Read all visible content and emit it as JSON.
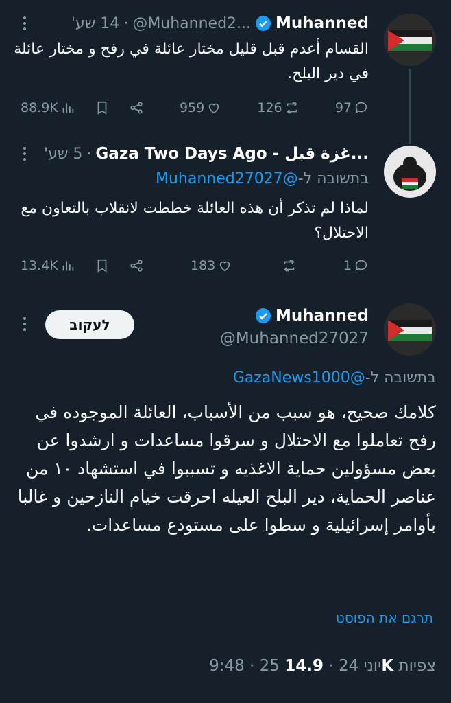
{
  "tweet1": {
    "name": "Muhanned",
    "handle": "@Muhanned2...",
    "time": "14 שע'",
    "text": "القسام أعدم قبل قليل مختار عائلة في رفح و مختار عائلة في دير البلح.",
    "stats": {
      "replies": "97",
      "reposts": "126",
      "likes": "959",
      "views": "88.9K"
    }
  },
  "tweet2": {
    "name": "Gaza Two Days Ago - غزة قبل...",
    "time": "5 שע'",
    "replying_prefix": "בתשובה ל-",
    "replying_to": "@Muhanned27027",
    "text": "لماذا لم تذكر أن هذه العائلة خططت لانقلاب بالتعاون مع الاحتلال؟",
    "stats": {
      "replies": "1",
      "reposts": "",
      "likes": "183",
      "views": "13.4K"
    }
  },
  "tweet3": {
    "name": "Muhanned",
    "handle": "@Muhanned27027",
    "follow_label": "לעקוב",
    "replying_prefix": "בתשובה ל-",
    "replying_to": "@GazaNews1000",
    "text": "كلامك صحيح، هو سبب من الأسباب، العائلة الموجوده في رفح تعاملوا مع الاحتلال و سرقوا مساعدات و ارشدوا عن بعض مسؤولين حماية الاغذيه و تسببوا في استشهاد ١٠ من عناصر الحماية، دير البلح العيله احرقت خيام النازحين و غالبا بأوامر إسرائيلية و سطوا على مستودع مساعدات.",
    "translate_label": "תרגם את הפוסט",
    "timestamp": "9:48 · 25 יוני 24 · ",
    "views": "14.9K",
    "views_label": "צפיות"
  },
  "colors": {
    "background": "#15202b",
    "accent": "#1d9bf0",
    "muted": "#8b98a5",
    "verified": "#1d9bf0"
  },
  "icons": [
    "verified-badge-icon",
    "more-icon",
    "reply-icon",
    "repost-icon",
    "like-icon",
    "views-icon",
    "bookmark-icon",
    "share-icon"
  ]
}
